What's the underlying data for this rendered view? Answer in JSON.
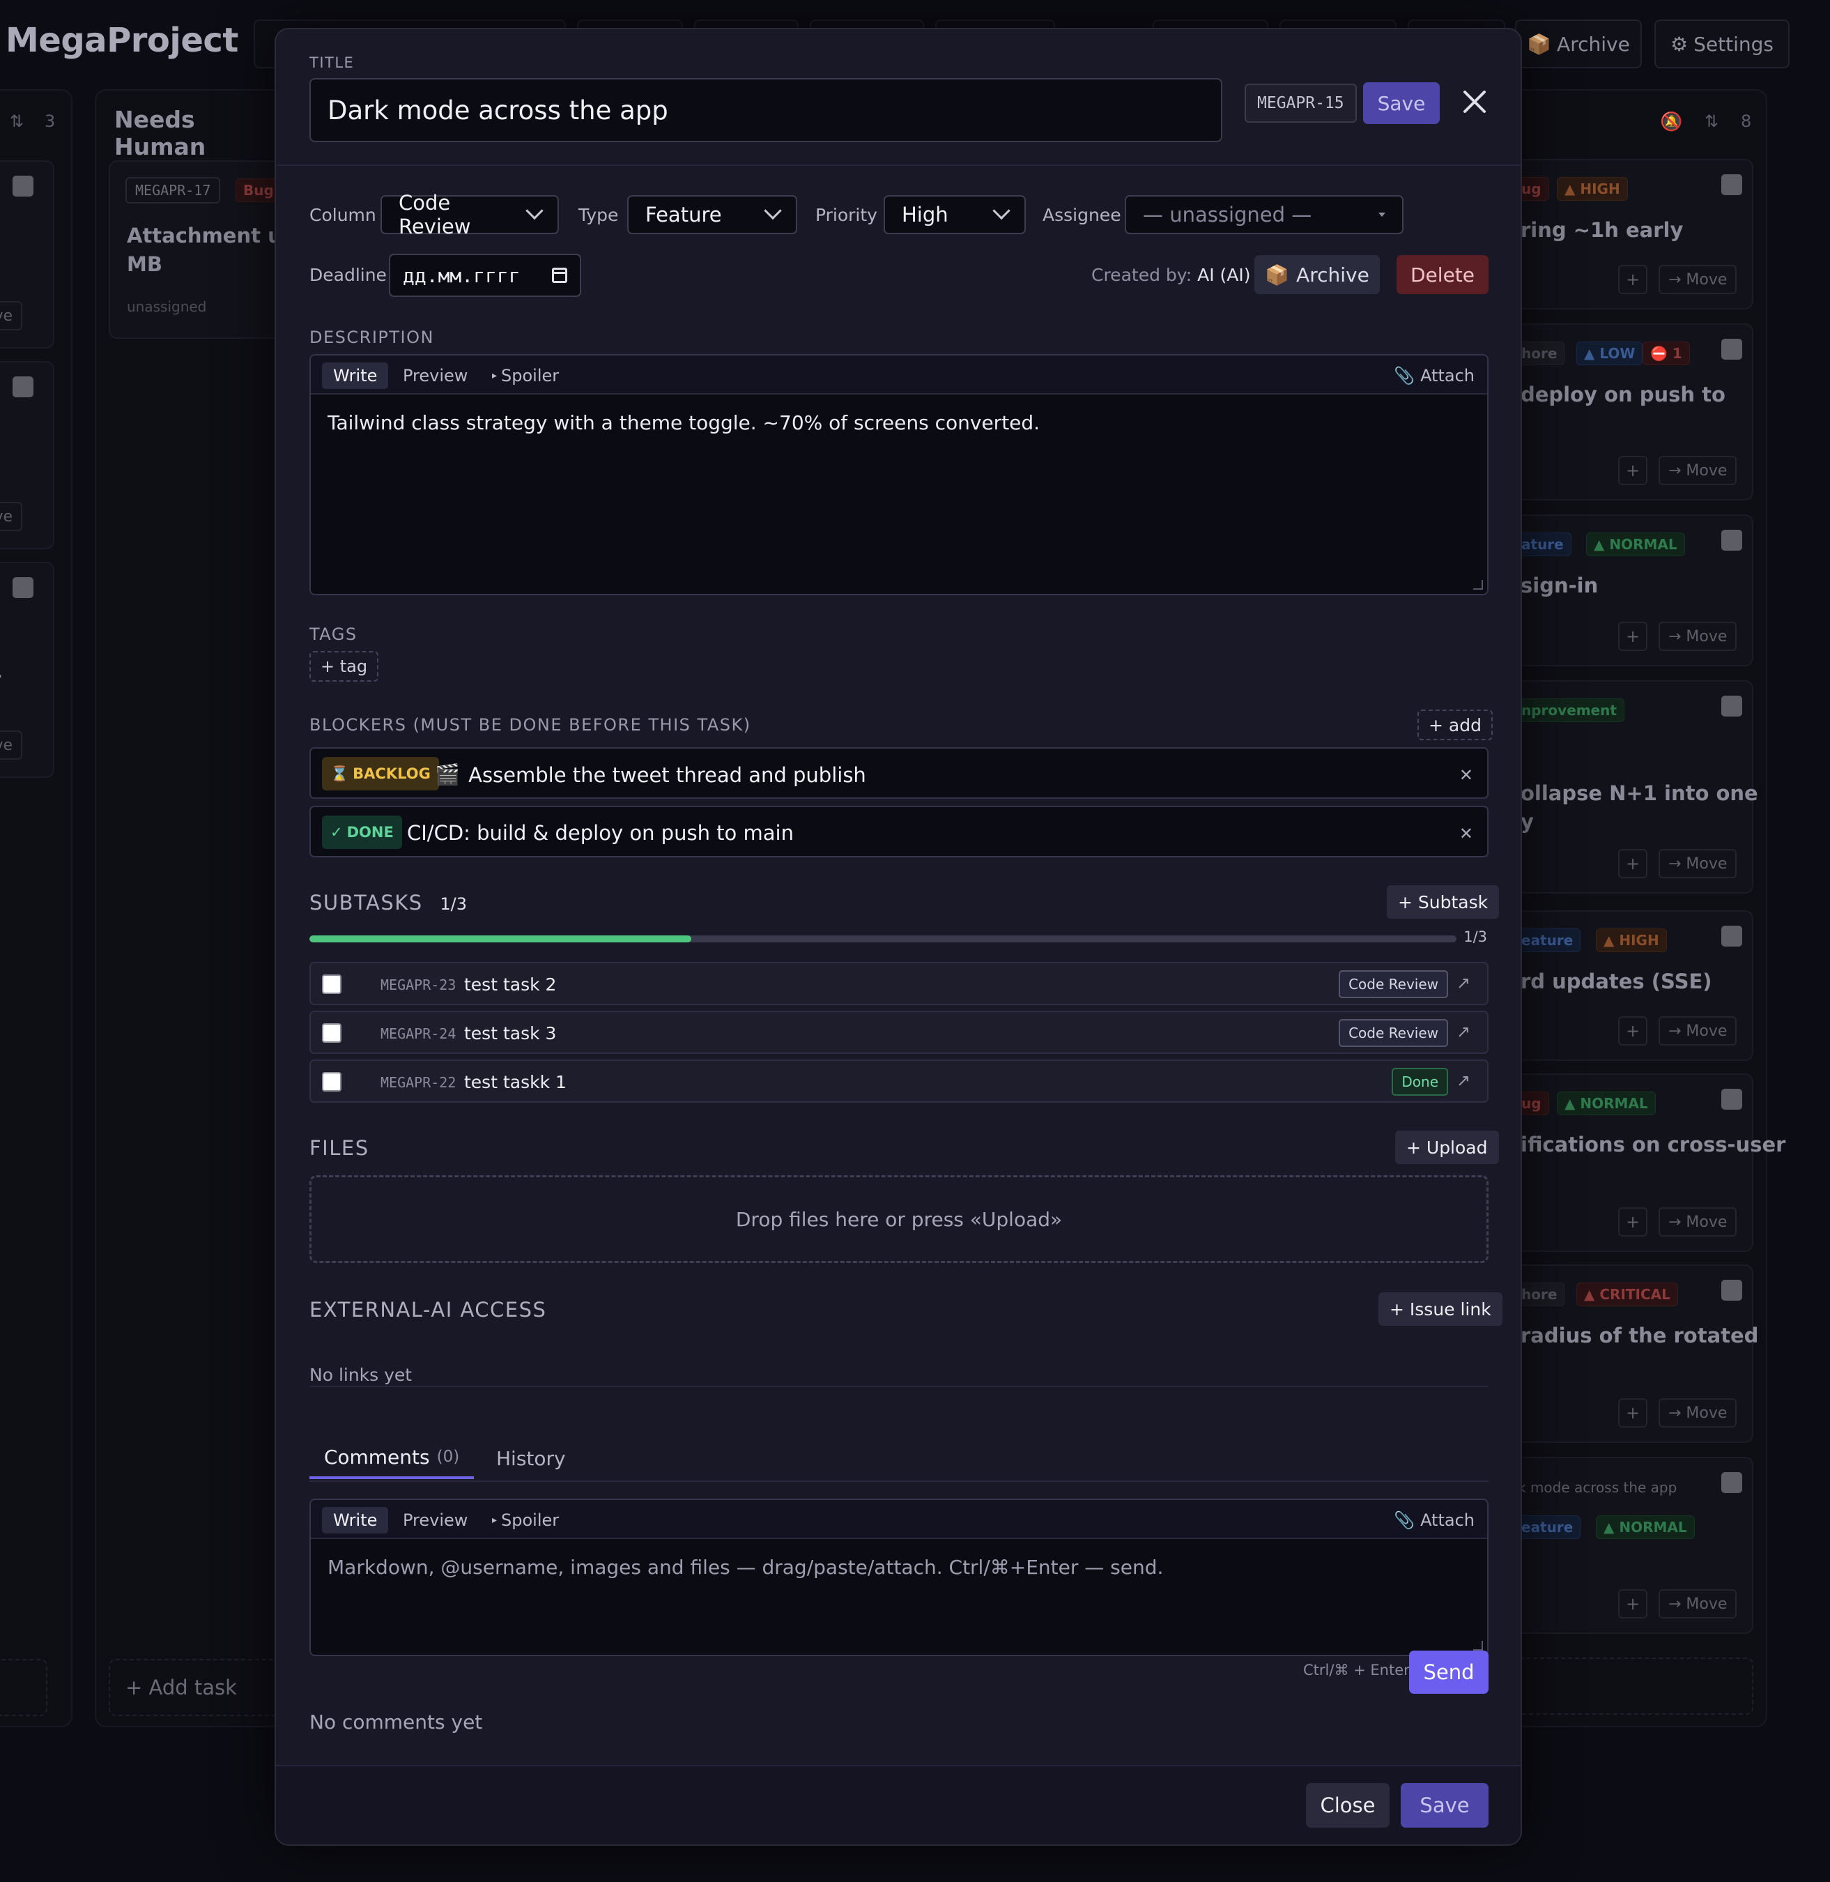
{
  "app": {
    "title": "MegaProject"
  },
  "toolbar": {
    "archive_label": "Archive",
    "settings_label": "Settings"
  },
  "board": {
    "left_col": {
      "count": "3",
      "move_label": "Move"
    },
    "needs_human": {
      "title": "Needs Human",
      "card": {
        "key": "MEGAPR-17",
        "type": "Bug",
        "title": "Attachment uplo\nMB",
        "assignee": "unassigned"
      },
      "add_task": "+ Add task"
    },
    "right_col": {
      "count": "8",
      "cards": [
        {
          "type": "ug",
          "priority": "▲ HIGH",
          "title": "ring ~1h early"
        },
        {
          "type": "hore",
          "priority": "▲ LOW",
          "extra": "⛔ 1",
          "title": "deploy on push to"
        },
        {
          "type": "ature",
          "priority": "▲ NORMAL",
          "title": "sign-in"
        },
        {
          "type": "nprovement",
          "priority": "",
          "title": "ollapse N+1 into one\ny"
        },
        {
          "type": "eature",
          "priority": "▲ HIGH",
          "title": "rd updates (SSE)"
        },
        {
          "type": "ug",
          "priority": "▲ NORMAL",
          "title": "ifications on cross-user"
        },
        {
          "type": "hore",
          "priority": "▲ CRITICAL",
          "title": "radius of the rotated"
        },
        {
          "type": "eature",
          "priority": "▲ NORMAL",
          "title": "k mode across the app"
        }
      ],
      "move_label": "Move"
    }
  },
  "modal": {
    "title_label": "TITLE",
    "title_value": "Dark mode across the app",
    "task_key": "MEGAPR-15",
    "save_label": "Save",
    "column_label": "Column",
    "column_value": "Code Review",
    "type_label": "Type",
    "type_value": "Feature",
    "priority_label": "Priority",
    "priority_value": "High",
    "assignee_label": "Assignee",
    "assignee_value": "— unassigned —",
    "deadline_label": "Deadline",
    "deadline_placeholder": "дд.мм.гггг",
    "created_by_label": "Created by:",
    "created_by_value": "AI (AI)",
    "archive_label": "Archive",
    "delete_label": "Delete",
    "description_label": "DESCRIPTION",
    "editor_tabs": {
      "write": "Write",
      "preview": "Preview",
      "spoiler": "Spoiler",
      "attach": "Attach"
    },
    "description_text": "Tailwind class strategy with a theme toggle. ~70% of screens converted.",
    "tags_label": "TAGS",
    "tag_add": "+ tag",
    "blockers_label": "BLOCKERS (MUST BE DONE BEFORE THIS TASK)",
    "blockers_add": "+ add",
    "blockers": [
      {
        "status": "BACKLOG",
        "status_icon": "⌛",
        "emoji": "🎬",
        "title": "Assemble the tweet thread and publish"
      },
      {
        "status": "DONE",
        "status_icon": "✓",
        "emoji": "",
        "title": "CI/CD: build & deploy on push to main"
      }
    ],
    "subtasks_label": "SUBTASKS",
    "subtasks_count": "1/3",
    "subtasks_progress": 0.333,
    "subtask_add": "+ Subtask",
    "subtasks": [
      {
        "key": "MEGAPR-23",
        "title": "test task 2",
        "status": "Code Review"
      },
      {
        "key": "MEGAPR-24",
        "title": "test task 3",
        "status": "Code Review"
      },
      {
        "key": "MEGAPR-22",
        "title": "test taskk 1",
        "status": "Done"
      }
    ],
    "files_label": "FILES",
    "upload_label": "+ Upload",
    "drop_text": "Drop files here or press «Upload»",
    "external_label": "EXTERNAL-AI ACCESS",
    "issue_link_label": "+ Issue link",
    "no_links": "No links yet",
    "comments_tab": "Comments",
    "comments_count": "(0)",
    "history_tab": "History",
    "comment_placeholder": "Markdown, @username, images and files — drag/paste/attach. Ctrl/⌘+Enter — send.",
    "send_hint": "Ctrl/⌘ + Enter",
    "send_label": "Send",
    "no_comments": "No comments yet",
    "close_label": "Close",
    "footer_save_label": "Save"
  },
  "colors": {
    "accent": "#6c5ff0",
    "save": "#4d46a8",
    "delete": "#5a1e25",
    "progress": "#4ec57e",
    "modal_bg": "#181826",
    "page_bg": "#0c0c14"
  }
}
